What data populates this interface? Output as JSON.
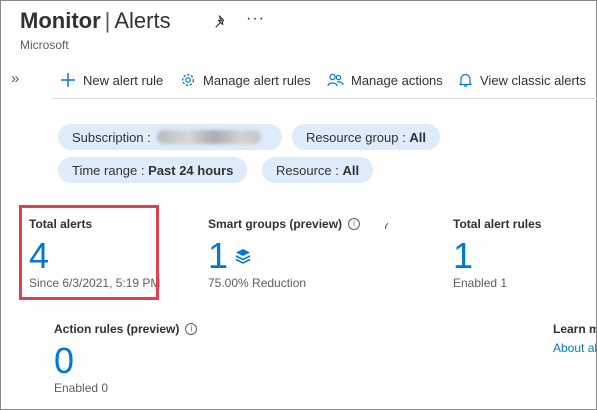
{
  "header": {
    "title_main": "Monitor",
    "title_sep": "|",
    "title_page": "Alerts",
    "subtitle": "Microsoft",
    "more_label": "···"
  },
  "nav": {
    "expand_label": "»"
  },
  "toolbar": {
    "new_alert_rule": "New alert rule",
    "manage_alert_rules": "Manage alert rules",
    "manage_actions": "Manage actions",
    "view_classic_alerts": "View classic alerts"
  },
  "filters": {
    "subscription": {
      "label": "Subscription :"
    },
    "resource_group": {
      "label": "Resource group :",
      "value": "All"
    },
    "time_range": {
      "label": "Time range :",
      "value": "Past 24 hours"
    },
    "resource": {
      "label": "Resource :",
      "value": "All"
    }
  },
  "tiles": {
    "total_alerts": {
      "label": "Total alerts",
      "value": "4",
      "sub": "Since 6/3/2021, 5:19 PM"
    },
    "smart_groups": {
      "label": "Smart groups (preview)",
      "value": "1",
      "sub": "75.00% Reduction"
    },
    "total_alert_rules": {
      "label": "Total alert rules",
      "value": "1",
      "sub": "Enabled 1"
    },
    "action_rules": {
      "label": "Action rules (preview)",
      "value": "0",
      "sub": "Enabled 0"
    },
    "learn_more": {
      "label": "Learn more",
      "link": "About alerts"
    }
  },
  "colors": {
    "accent": "#0078d4",
    "pill_bg": "#deecf9",
    "highlight": "#e2414b"
  }
}
